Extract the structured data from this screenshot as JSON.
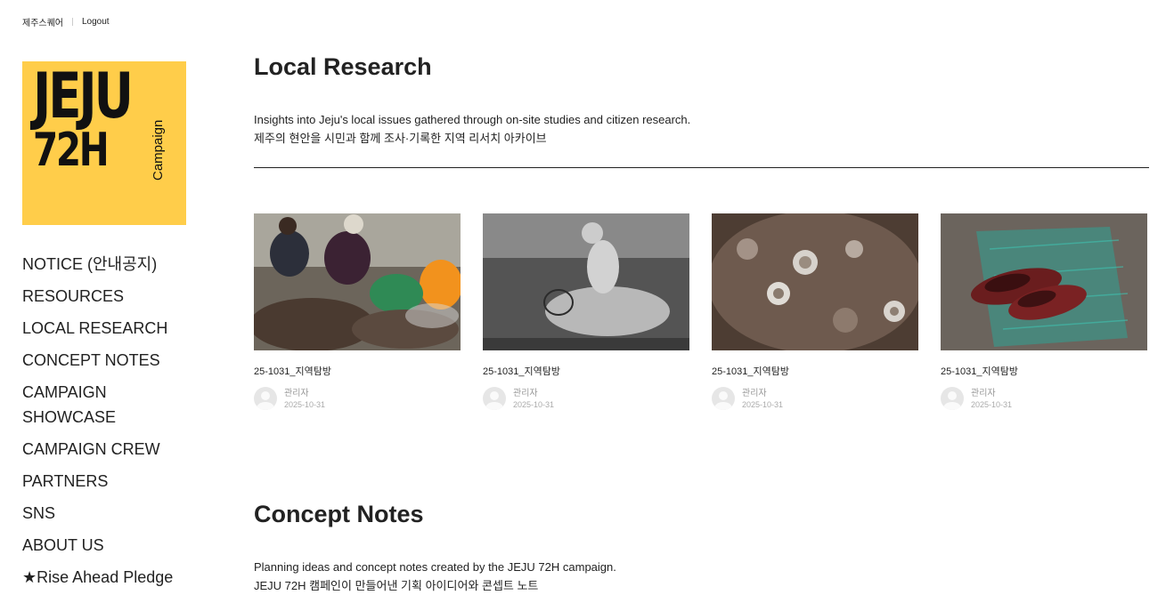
{
  "topbar": {
    "site_link": "제주스퀘어",
    "logout": "Logout"
  },
  "logo": {
    "line1": "JEJU",
    "line2": "72H",
    "vertical": "Campaign",
    "bg_color": "#ffcd4a"
  },
  "nav": {
    "items": [
      {
        "label": "NOTICE (안내공지)"
      },
      {
        "label": "RESOURCES"
      },
      {
        "label": "LOCAL RESEARCH"
      },
      {
        "label": "CONCEPT NOTES"
      },
      {
        "label": "CAMPAIGN SHOWCASE"
      },
      {
        "label": "CAMPAIGN CREW"
      },
      {
        "label": "PARTNERS"
      },
      {
        "label": "SNS"
      },
      {
        "label": "ABOUT US"
      },
      {
        "label": "★Rise Ahead Pledge"
      }
    ]
  },
  "local_research": {
    "title": "Local Research",
    "desc_en": "Insights into Jeju's local issues gathered through on-site studies and citizen research.",
    "desc_ko": "제주의 현안을 시민과 함께 조사·기록한 지역 리서치 아카이브",
    "posts": [
      {
        "title": "25-1031_지역탐방",
        "author": "관리자",
        "date": "2025-10-31",
        "image": "women-sorting-shellfish"
      },
      {
        "title": "25-1031_지역탐방",
        "author": "관리자",
        "date": "2025-10-31",
        "image": "haenyeo-bw-photo"
      },
      {
        "title": "25-1031_지역탐방",
        "author": "관리자",
        "date": "2025-10-31",
        "image": "turban-shells-closeup"
      },
      {
        "title": "25-1031_지역탐방",
        "author": "관리자",
        "date": "2025-10-31",
        "image": "red-shoes-and-net"
      }
    ]
  },
  "concept_notes": {
    "title": "Concept Notes",
    "desc_en": "Planning ideas and concept notes created by the JEJU 72H campaign.",
    "desc_ko": "JEJU 72H 캠페인이 만들어낸 기획 아이디어와 콘셉트 노트"
  }
}
